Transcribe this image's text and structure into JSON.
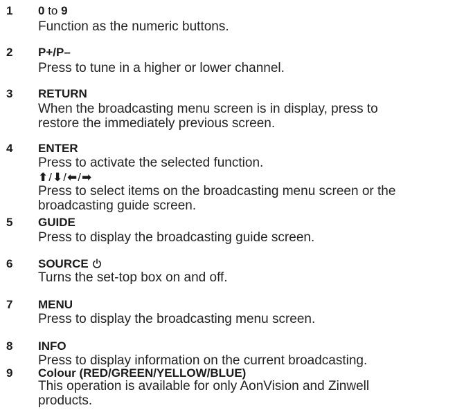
{
  "items": [
    {
      "number": "1",
      "heading_parts": [
        "0",
        " to ",
        "9"
      ],
      "lines": [
        "Function as the numeric buttons."
      ]
    },
    {
      "number": "2",
      "heading": "P+/P–",
      "lines": [
        "Press to tune in a higher or lower channel."
      ]
    },
    {
      "number": "3",
      "heading": "RETURN",
      "lines": [
        "When the broadcasting menu screen is in display, press to",
        "restore the immediately previous screen."
      ]
    },
    {
      "number": "4",
      "heading": "ENTER",
      "lines": [
        "Press to activate the selected function."
      ],
      "arrow_glyphs": [
        "⬆",
        "⬇",
        "⬅",
        "➡"
      ],
      "arrow_separator": "/",
      "lines_after_arrows": [
        "Press to select items on the broadcasting menu screen or the",
        "broadcasting guide screen."
      ]
    },
    {
      "number": "5",
      "heading": "GUIDE",
      "lines": [
        "Press to display the broadcasting guide screen."
      ]
    },
    {
      "number": "6",
      "heading": "SOURCE",
      "icon": "power-icon",
      "lines": [
        "Turns the set-top box on and off."
      ]
    },
    {
      "number": "7",
      "heading": "MENU",
      "lines": [
        "Press to display the broadcasting menu screen."
      ]
    },
    {
      "number": "8",
      "heading": "INFO",
      "lines": [
        "Press to display information on the current broadcasting."
      ]
    },
    {
      "number": "9",
      "heading": "Colour (RED/GREEN/YELLOW/BLUE)",
      "lines": [
        "This operation is available for only AonVision and Zinwell",
        "products."
      ]
    }
  ]
}
